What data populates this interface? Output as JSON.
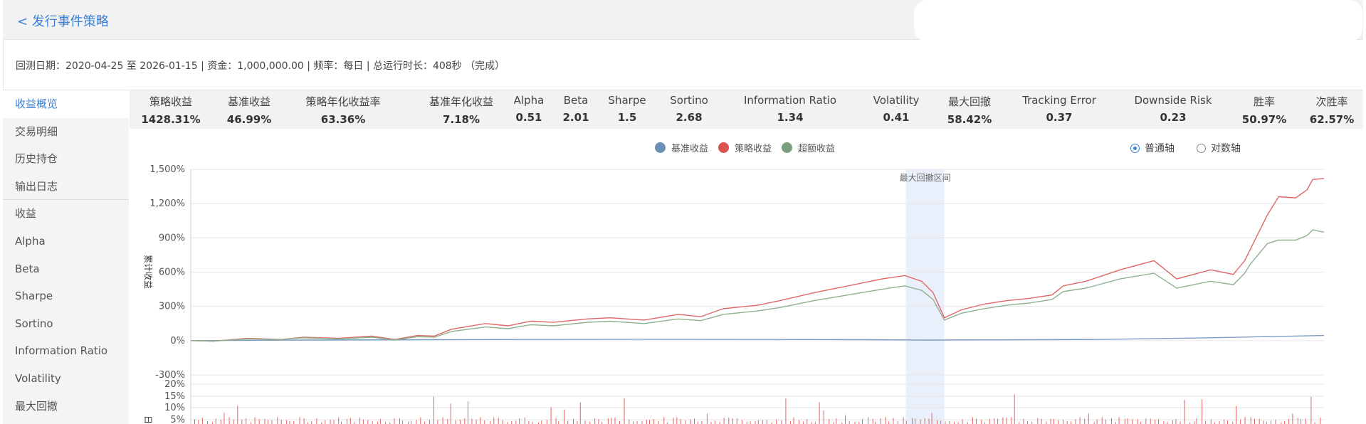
{
  "header": {
    "back_label": "< 发行事件策略"
  },
  "info": {
    "text": "回测日期：2020-04-25 至 2026-01-15 | 资金：1,000,000.00 | 频率：每日 | 总运行时长：408秒 （完成）"
  },
  "sidebar": {
    "items": [
      {
        "label": "收益概览",
        "active": true
      },
      {
        "label": "交易明细"
      },
      {
        "label": "历史持仓"
      },
      {
        "label": "输出日志"
      },
      {
        "label": "收益"
      },
      {
        "label": "Alpha"
      },
      {
        "label": "Beta"
      },
      {
        "label": "Sharpe"
      },
      {
        "label": "Sortino"
      },
      {
        "label": "Information Ratio"
      },
      {
        "label": "Volatility"
      },
      {
        "label": "最大回撤"
      }
    ]
  },
  "stats": [
    {
      "label": "策略收益",
      "value": "1428.31%"
    },
    {
      "label": "基准收益",
      "value": "46.99%"
    },
    {
      "label": "策略年化收益率",
      "value": "63.36%"
    },
    {
      "label": "基准年化收益",
      "value": "7.18%"
    },
    {
      "label": "Alpha",
      "value": "0.51"
    },
    {
      "label": "Beta",
      "value": "2.01"
    },
    {
      "label": "Sharpe",
      "value": "1.5"
    },
    {
      "label": "Sortino",
      "value": "2.68"
    },
    {
      "label": "Information Ratio",
      "value": "1.34"
    },
    {
      "label": "Volatility",
      "value": "0.41"
    },
    {
      "label": "最大回撤",
      "value": "58.42%"
    },
    {
      "label": "Tracking Error",
      "value": "0.37"
    },
    {
      "label": "Downside Risk",
      "value": "0.23"
    },
    {
      "label": "胜率",
      "value": "50.97%"
    },
    {
      "label": "次胜率",
      "value": "62.57%"
    }
  ],
  "legend": [
    {
      "name": "基准收益",
      "color": "#6b8fb5"
    },
    {
      "name": "策略收益",
      "color": "#d9534f"
    },
    {
      "name": "超额收益",
      "color": "#7a9e7e"
    }
  ],
  "axis_mode": {
    "normal_label": "普通轴",
    "log_label": "对数轴",
    "selected": "normal"
  },
  "chart_data": {
    "type": "line",
    "ylabel": "累计收益",
    "ylim": [
      -300,
      1500
    ],
    "y_ticks": [
      "1,500%",
      "1,200%",
      "900%",
      "600%",
      "300%",
      "0%",
      "-300%"
    ],
    "x_range": [
      "2020-04-25",
      "2026-01-15"
    ],
    "annotation": "最大回撤区间",
    "drawdown_x": [
      0.631,
      0.665
    ],
    "series": [
      {
        "name": "基准收益",
        "color": "#7b9cc4",
        "x": [
          0,
          0.1,
          0.2,
          0.3,
          0.4,
          0.5,
          0.6,
          0.65,
          0.7,
          0.8,
          0.9,
          0.95,
          1.0
        ],
        "values": [
          0,
          5,
          8,
          10,
          12,
          10,
          8,
          5,
          7,
          10,
          25,
          35,
          45
        ]
      },
      {
        "name": "策略收益",
        "color": "#e06666",
        "x": [
          0,
          0.02,
          0.05,
          0.08,
          0.1,
          0.13,
          0.16,
          0.18,
          0.2,
          0.215,
          0.23,
          0.26,
          0.28,
          0.3,
          0.32,
          0.35,
          0.37,
          0.4,
          0.43,
          0.45,
          0.47,
          0.5,
          0.52,
          0.55,
          0.58,
          0.61,
          0.63,
          0.645,
          0.655,
          0.665,
          0.68,
          0.7,
          0.72,
          0.74,
          0.76,
          0.77,
          0.79,
          0.82,
          0.85,
          0.87,
          0.9,
          0.92,
          0.93,
          0.935,
          0.95,
          0.96,
          0.975,
          0.985,
          0.99,
          1.0
        ],
        "values": [
          0,
          -5,
          20,
          10,
          30,
          20,
          40,
          10,
          45,
          40,
          100,
          150,
          130,
          170,
          160,
          190,
          200,
          180,
          230,
          210,
          280,
          310,
          350,
          420,
          480,
          540,
          570,
          520,
          420,
          200,
          270,
          320,
          350,
          370,
          400,
          480,
          520,
          620,
          700,
          540,
          620,
          580,
          700,
          800,
          1100,
          1260,
          1250,
          1320,
          1410,
          1420
        ]
      },
      {
        "name": "超额收益",
        "color": "#8fb08f",
        "x": [
          0,
          0.02,
          0.05,
          0.08,
          0.1,
          0.13,
          0.16,
          0.18,
          0.2,
          0.215,
          0.23,
          0.26,
          0.28,
          0.3,
          0.32,
          0.35,
          0.37,
          0.4,
          0.43,
          0.45,
          0.47,
          0.5,
          0.52,
          0.55,
          0.58,
          0.61,
          0.63,
          0.645,
          0.655,
          0.665,
          0.68,
          0.7,
          0.72,
          0.74,
          0.76,
          0.77,
          0.79,
          0.82,
          0.85,
          0.87,
          0.9,
          0.92,
          0.93,
          0.935,
          0.95,
          0.96,
          0.975,
          0.985,
          0.99,
          1.0
        ],
        "values": [
          0,
          -5,
          15,
          10,
          25,
          15,
          30,
          5,
          35,
          30,
          80,
          120,
          105,
          140,
          130,
          160,
          170,
          150,
          190,
          175,
          230,
          260,
          290,
          350,
          400,
          450,
          480,
          440,
          360,
          180,
          240,
          280,
          310,
          330,
          360,
          430,
          460,
          540,
          590,
          460,
          520,
          490,
          590,
          670,
          850,
          880,
          880,
          920,
          970,
          950
        ]
      }
    ]
  },
  "daily_chart": {
    "y_ticks": [
      "20%",
      "15%",
      "10%",
      "5%"
    ],
    "ylabel": "日"
  }
}
